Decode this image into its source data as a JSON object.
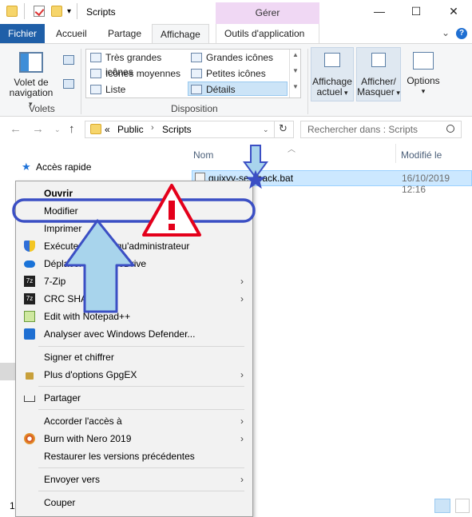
{
  "window": {
    "title": "Scripts",
    "context_tab": "Gérer",
    "controls": {
      "minimize": "—",
      "maximize": "☐",
      "close": "✕"
    }
  },
  "ribbon": {
    "tabs": [
      {
        "label": "Fichier"
      },
      {
        "label": "Accueil"
      },
      {
        "label": "Partage"
      },
      {
        "label": "Affichage"
      },
      {
        "label": "Outils d'application"
      }
    ],
    "volets": {
      "button_line1": "Volet de",
      "button_line2": "navigation",
      "group_label": "Volets"
    },
    "disposition": {
      "items": [
        "Très grandes icônes",
        "Grandes icônes",
        "Icônes moyennes",
        "Petites icônes",
        "Liste",
        "Détails"
      ],
      "group_label": "Disposition"
    },
    "affichage_actuel": {
      "line1": "Affichage",
      "line2": "actuel"
    },
    "afficher_masquer": {
      "line1": "Afficher/",
      "line2": "Masquer"
    },
    "options": {
      "label": "Options"
    }
  },
  "addressbar": {
    "prefix": "«",
    "crumbs": [
      "Public",
      "Scripts"
    ],
    "search_placeholder": "Rechercher dans : Scripts"
  },
  "navpane": {
    "quick_access": "Accès rapide"
  },
  "filelist": {
    "columns": {
      "name": "Nom",
      "date": "Modifié le"
    },
    "file": {
      "name": "guixyy-se...back.bat",
      "date": "16/10/2019 12:16"
    }
  },
  "statusbar": {
    "count": "1"
  },
  "context_menu": {
    "items": [
      {
        "label": "Ouvrir"
      },
      {
        "label": "Modifier"
      },
      {
        "label": "Imprimer"
      },
      {
        "label": "Exécuter en tant qu'administrateur"
      },
      {
        "label": "Déplacer vers OneDrive"
      },
      {
        "label": "7-Zip"
      },
      {
        "label": "CRC SHA"
      },
      {
        "label": "Edit with Notepad++"
      },
      {
        "label": "Analyser avec Windows Defender..."
      },
      {
        "label": "Signer et chiffrer"
      },
      {
        "label": "Plus d'options GpgEX"
      },
      {
        "label": "Partager"
      },
      {
        "label": "Accorder l'accès à"
      },
      {
        "label": "Burn with Nero 2019"
      },
      {
        "label": "Restaurer les versions précédentes"
      },
      {
        "label": "Envoyer vers"
      },
      {
        "label": "Couper"
      }
    ]
  },
  "colors": {
    "fichier_tab": "#1f5fa8",
    "manage_tab": "#f0d8f4",
    "selection": "#cce8ff",
    "annotation_blue": "#3b4fc4",
    "annotation_red": "#e4001b"
  }
}
